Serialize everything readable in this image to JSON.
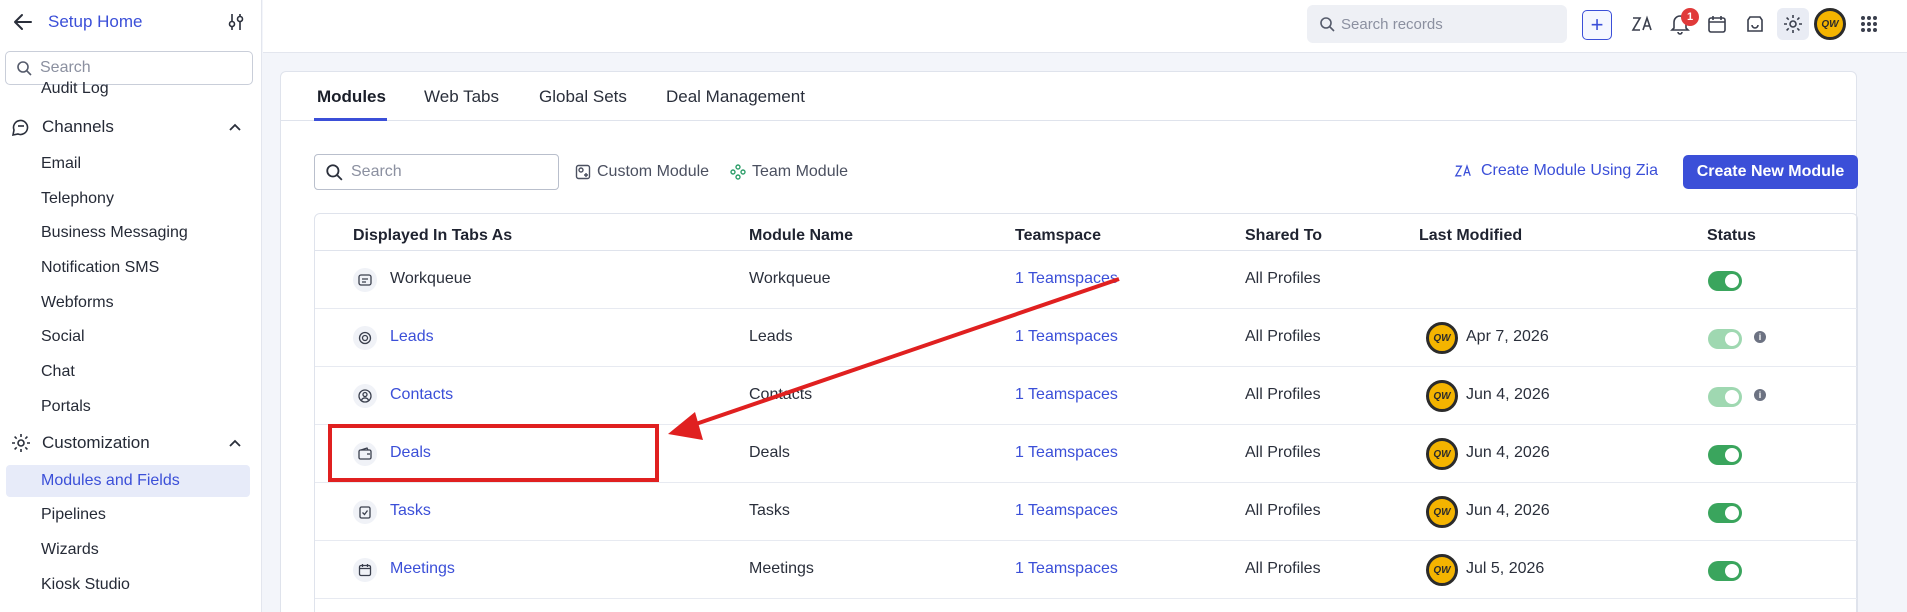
{
  "sidebar": {
    "title": "Setup Home",
    "search_placeholder": "Search",
    "cut_item": "Audit Log",
    "groups": [
      {
        "label": "Channels",
        "items": [
          "Email",
          "Telephony",
          "Business Messaging",
          "Notification SMS",
          "Webforms",
          "Social",
          "Chat",
          "Portals"
        ]
      },
      {
        "label": "Customization",
        "items": [
          "Modules and Fields",
          "Pipelines",
          "Wizards",
          "Kiosk Studio"
        ]
      }
    ],
    "active_item": "Modules and Fields"
  },
  "topbar": {
    "search_placeholder": "Search records",
    "notification_count": "1",
    "avatar_text": "QW"
  },
  "tabs": [
    "Modules",
    "Web Tabs",
    "Global Sets",
    "Deal Management"
  ],
  "active_tab": "Modules",
  "toolbar": {
    "search_placeholder": "Search",
    "custom_module": "Custom Module",
    "team_module": "Team Module",
    "zia_link": "Create Module Using Zia",
    "create_button": "Create New Module"
  },
  "table": {
    "headers": [
      "Displayed In Tabs As",
      "Module Name",
      "Teamspace",
      "Shared To",
      "Last Modified",
      "Status"
    ],
    "rows": [
      {
        "tab": "Workqueue",
        "module": "Workqueue",
        "teamspace": "1 Teamspaces",
        "shared": "All Profiles",
        "modified": "",
        "status": "on",
        "tab_link": false
      },
      {
        "tab": "Leads",
        "module": "Leads",
        "teamspace": "1 Teamspaces",
        "shared": "All Profiles",
        "modified": "Apr 7, 2026",
        "status": "locked",
        "tab_link": true
      },
      {
        "tab": "Contacts",
        "module": "Contacts",
        "teamspace": "1 Teamspaces",
        "shared": "All Profiles",
        "modified": "Jun 4, 2026",
        "status": "locked",
        "tab_link": true
      },
      {
        "tab": "Deals",
        "module": "Deals",
        "teamspace": "1 Teamspaces",
        "shared": "All Profiles",
        "modified": "Jun 4, 2026",
        "status": "on",
        "tab_link": true
      },
      {
        "tab": "Tasks",
        "module": "Tasks",
        "teamspace": "1 Teamspaces",
        "shared": "All Profiles",
        "modified": "Jun 4, 2026",
        "status": "on",
        "tab_link": true
      },
      {
        "tab": "Meetings",
        "module": "Meetings",
        "teamspace": "1 Teamspaces",
        "shared": "All Profiles",
        "modified": "Jul 5, 2026",
        "status": "on",
        "tab_link": true
      }
    ]
  },
  "colors": {
    "accent": "#3b4fd8",
    "toggle_on": "#3aa55d",
    "annotation": "#e02020"
  }
}
